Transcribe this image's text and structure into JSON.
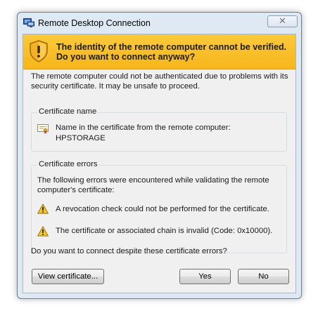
{
  "window": {
    "title": "Remote Desktop Connection",
    "close_label": "✕"
  },
  "banner": {
    "message": "The identity of the remote computer cannot be verified. Do you want to connect anyway?",
    "color": "#f9bf2b"
  },
  "intro": "The remote computer could not be authenticated due to problems with its security certificate. It may be unsafe to proceed.",
  "certificate_name": {
    "legend": "Certificate name",
    "label": "Name in the certificate from the remote computer:",
    "value": "HPSTORAGE"
  },
  "certificate_errors": {
    "legend": "Certificate errors",
    "description": "The following errors were encountered while validating the remote computer's certificate:",
    "errors": [
      "A revocation check could not be performed for the certificate.",
      "The certificate or associated chain is invalid (Code: 0x10000)."
    ]
  },
  "question": "Do you want to connect despite these certificate errors?",
  "buttons": {
    "view_certificate": "View certificate...",
    "yes": "Yes",
    "no": "No"
  },
  "icons": {
    "app": "remote-desktop-icon",
    "banner": "security-shield-warning-icon",
    "certificate": "certificate-icon",
    "error": "warning-icon"
  }
}
